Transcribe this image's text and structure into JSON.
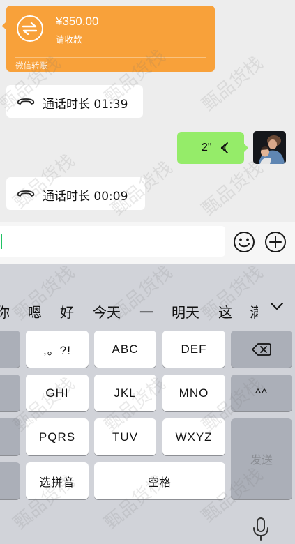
{
  "chat": {
    "transfer": {
      "amount": "¥350.00",
      "status": "请收款",
      "footer": "微信转账",
      "color": "#f8a13a"
    },
    "calls": [
      {
        "label": "通话时长 01:39",
        "icon": "phone-hangup-icon"
      },
      {
        "label": "通话时长 00:09",
        "icon": "phone-hangup-icon"
      }
    ],
    "voice_message": {
      "duration": "2\"",
      "icon": "voice-wave-icon",
      "color": "#95ec69"
    },
    "avatar": {
      "icon": "avatar"
    }
  },
  "input_bar": {
    "text_value": "",
    "emoji_icon": "smiley-icon",
    "plus_icon": "plus-circle-icon"
  },
  "keyboard": {
    "candidates": [
      "你",
      "嗯",
      "好",
      "今天",
      "一",
      "明天",
      "这",
      "满"
    ],
    "expand_icon": "chevron-down-icon",
    "keys": {
      "punct": ",。?!",
      "abc": "ABC",
      "def": "DEF",
      "ghi": "GHI",
      "jkl": "JKL",
      "mno": "MNO",
      "pqrs": "PQRS",
      "tuv": "TUV",
      "wxyz": "WXYZ",
      "caret": "^^",
      "send": "发送",
      "pinyin": "选拼音",
      "space": "空格"
    },
    "mic_icon": "microphone-icon"
  },
  "watermark": "甄品货栈"
}
